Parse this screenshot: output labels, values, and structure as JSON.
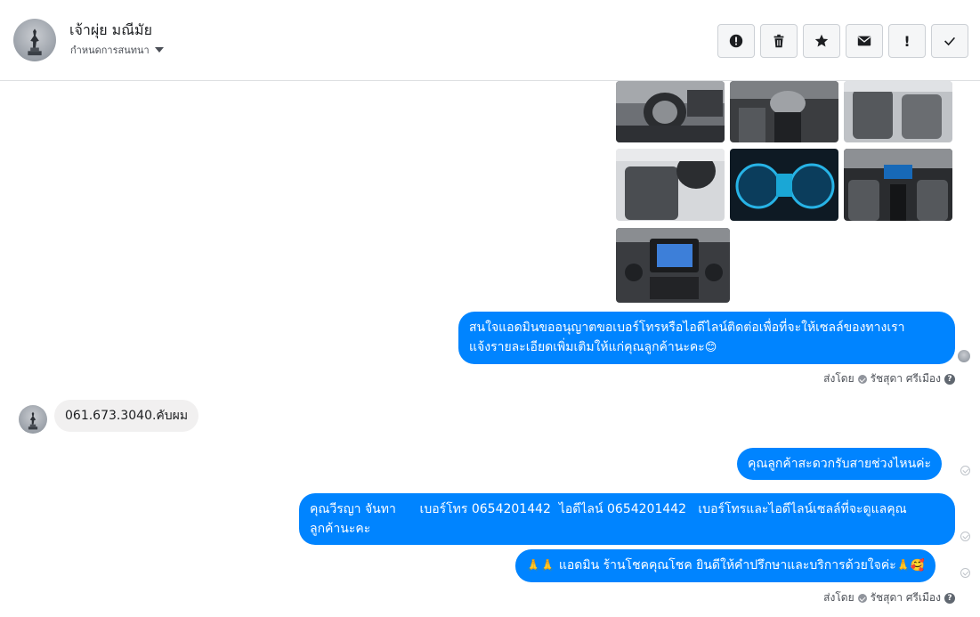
{
  "header": {
    "name": "เจ้าผุ่ย มณีมัย",
    "assign_label": "กำหนดการสนทนา"
  },
  "toolbar": {
    "buttons": [
      {
        "icon": "alert-circle-icon"
      },
      {
        "icon": "trash-icon"
      },
      {
        "icon": "star-icon"
      },
      {
        "icon": "envelope-icon"
      },
      {
        "icon": "exclamation-icon",
        "label": "!"
      },
      {
        "icon": "checkmark-icon"
      }
    ]
  },
  "messages": {
    "msg1": {
      "line1": "สนใจแอดมินขออนุญาตขอเบอร์โทรหรือไอดีไลน์ติดต่อเพื่อที่จะให้เซลล์ของทางเรา",
      "line2": "แจ้งรายละเอียดเพิ่มเติมให้แก่คุณลูกค้านะคะ",
      "emoji": "😊"
    },
    "sent_by_1": {
      "prefix": "ส่งโดย",
      "name": "รัชสุดา ศรีเมือง"
    },
    "incoming": {
      "text": "061.673.3040.คับผม"
    },
    "msg2": {
      "text": "คุณลูกค้าสะดวกรับสายช่วงไหนค่ะ"
    },
    "msg3": {
      "line1": "คุณวีรญา จันทา      เบอร์โทร 0654201442  ไอดีไลน์ 0654201442   เบอร์โทรและไอดีไลน์เซลล์ที่จะดูแลคุณ",
      "line2": "ลูกค้านะคะ"
    },
    "msg4": {
      "emoji_start": "🙏🙏",
      "text": "แอดมิน ร้านโชคคุณโชค ยินดีให้คำปรึกษาและบริการด้วยใจค่ะ",
      "emoji_end": "🙏🥰"
    },
    "sent_by_2": {
      "prefix": "ส่งโดย",
      "name": "รัชสุดา ศรีเมือง"
    }
  },
  "colors": {
    "outgoing_bubble": "#0084ff",
    "incoming_bubble": "#f1f0f0"
  }
}
